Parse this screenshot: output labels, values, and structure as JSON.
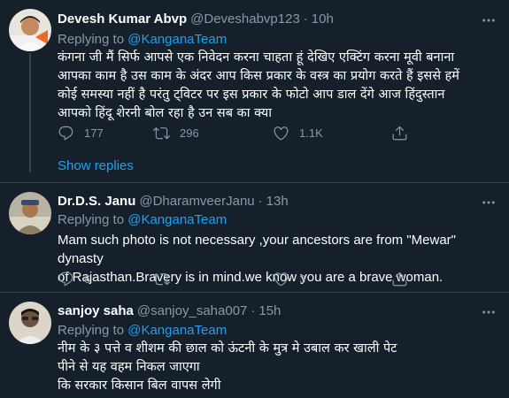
{
  "tweets": [
    {
      "name": "Devesh Kumar Abvp",
      "handle": "@Deveshabvp123",
      "time": "10h",
      "replying_prefix": "Replying to ",
      "replying_to": "@KanganaTeam",
      "text": "कंगना जी मैं सिर्फ आपसे एक निवेदन करना चाहता हूं देखिए एक्टिंग करना मूवी बनाना\nआपका काम है उस काम के अंदर आप किस प्रकार के वस्त्र का प्रयोग करते हैं इससे हमें\nकोई समस्या नहीं है परंतु ट्विटर पर इस प्रकार के फोटो आप डाल देंगे आज हिंदुस्तान\nआपको हिंदू शेरनी बोल रहा है उन सब का क्या",
      "replies": "177",
      "retweets": "296",
      "likes": "1.1K",
      "show_replies": "Show replies"
    },
    {
      "name": "Dr.D.S. Janu",
      "handle": "@DharamveerJanu",
      "time": "13h",
      "replying_prefix": "Replying to ",
      "replying_to": "@KanganaTeam",
      "text": "Mam such photo is not necessary ,your ancestors are from \"Mewar\" dynasty\nof Rajasthan.Bravery is in mind.we know you are a brave woman.",
      "replies": "6",
      "retweets": "",
      "likes": "3"
    },
    {
      "name": "sanjoy saha",
      "handle": "@sanjoy_saha007",
      "time": "15h",
      "replying_prefix": "Replying to ",
      "replying_to": "@KanganaTeam",
      "text": "नीम के ३ पत्ते व शीशम की छाल को ऊंटनी के मुत्र मे उबाल कर खाली पेट\nपीने से यह वहम निकल जाएगा\nकि सरकार किसान बिल वापस लेगी"
    }
  ],
  "separator": "·",
  "icons": {
    "reply": "reply-icon",
    "retweet": "retweet-icon",
    "like": "heart-icon",
    "share": "share-icon",
    "more": "more-icon"
  },
  "colors": {
    "background": "#15202b",
    "secondary_text": "#8899a6",
    "accent": "#1da1f2",
    "divider": "#38444d"
  }
}
